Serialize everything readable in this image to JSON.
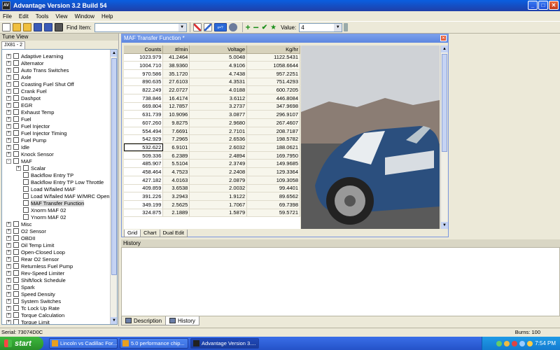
{
  "window": {
    "title": "Advantage Version 3.2 Build 54",
    "app_icon_text": "AV"
  },
  "menu": [
    "File",
    "Edit",
    "Tools",
    "View",
    "Window",
    "Help"
  ],
  "toolbar": {
    "find_label": "Find Item:",
    "find_value": "",
    "value_label": "Value:",
    "value_value": "4",
    "box_icon_text": "x=?"
  },
  "tune_view": {
    "title": "Tune View",
    "tab": "JX81 - 2",
    "items": [
      {
        "label": "Adaptive Learning",
        "level": 0,
        "expander": "+"
      },
      {
        "label": "Alternator",
        "level": 0,
        "expander": "+"
      },
      {
        "label": "Auto Trans Switches",
        "level": 0,
        "expander": "+"
      },
      {
        "label": "Axle",
        "level": 0,
        "expander": "+"
      },
      {
        "label": "Coasting Fuel Shut Off",
        "level": 0,
        "expander": "+"
      },
      {
        "label": "Crank Fuel",
        "level": 0,
        "expander": "+"
      },
      {
        "label": "Dashpot",
        "level": 0,
        "expander": "+"
      },
      {
        "label": "EGR",
        "level": 0,
        "expander": "+"
      },
      {
        "label": "Exhaust Temp",
        "level": 0,
        "expander": "+"
      },
      {
        "label": "Fuel",
        "level": 0,
        "expander": "+"
      },
      {
        "label": "Fuel Injector",
        "level": 0,
        "expander": "+"
      },
      {
        "label": "Fuel Injector Timing",
        "level": 0,
        "expander": "+"
      },
      {
        "label": "Fuel Pump",
        "level": 0,
        "expander": "+"
      },
      {
        "label": "Idle",
        "level": 0,
        "expander": "+"
      },
      {
        "label": "Knock Sensor",
        "level": 0,
        "expander": "+"
      },
      {
        "label": "MAF",
        "level": 0,
        "expander": "-"
      },
      {
        "label": "Scalar",
        "level": 1,
        "expander": "+"
      },
      {
        "label": "Backflow Entry TP",
        "level": 1,
        "expander": ""
      },
      {
        "label": "Backflow Entry TP Low Throttle",
        "level": 1,
        "expander": ""
      },
      {
        "label": "Load W/failed MAF",
        "level": 1,
        "expander": ""
      },
      {
        "label": "Load W/failed MAF W/MRC Open",
        "level": 1,
        "expander": ""
      },
      {
        "label": "MAF Transfer Function",
        "level": 1,
        "expander": "",
        "selected": true
      },
      {
        "label": "Xnorm MAF 02",
        "level": 1,
        "expander": ""
      },
      {
        "label": "Ynorm MAF 02",
        "level": 1,
        "expander": ""
      },
      {
        "label": "Misc",
        "level": 0,
        "expander": "+"
      },
      {
        "label": "O2 Sensor",
        "level": 0,
        "expander": "+"
      },
      {
        "label": "OBDII",
        "level": 0,
        "expander": "+"
      },
      {
        "label": "Oil Temp Limit",
        "level": 0,
        "expander": "+"
      },
      {
        "label": "Open-Closed Loop",
        "level": 0,
        "expander": "+"
      },
      {
        "label": "Rear O2 Sensor",
        "level": 0,
        "expander": "+"
      },
      {
        "label": "Returnless Fuel Pump",
        "level": 0,
        "expander": "+"
      },
      {
        "label": "Rev-Speed Limiter",
        "level": 0,
        "expander": "+"
      },
      {
        "label": "Shift/lock Schedule",
        "level": 0,
        "expander": "+"
      },
      {
        "label": "Spark",
        "level": 0,
        "expander": "+"
      },
      {
        "label": "Speed Density",
        "level": 0,
        "expander": "+"
      },
      {
        "label": "System Switches",
        "level": 0,
        "expander": "+"
      },
      {
        "label": "Tc Lock Up Rate",
        "level": 0,
        "expander": "+"
      },
      {
        "label": "Torque Calculation",
        "level": 0,
        "expander": "+"
      },
      {
        "label": "Torque Limit",
        "level": 0,
        "expander": "+"
      }
    ]
  },
  "maf_window": {
    "title": "MAF Transfer Function *",
    "columns": [
      "Counts",
      "#/min",
      "Voltage",
      "Kg/hr"
    ],
    "rows": [
      [
        "1023.979",
        "41.2464",
        "5.0048",
        "1122.5431"
      ],
      [
        "1004.710",
        "38.9360",
        "4.9106",
        "1058.6644"
      ],
      [
        "970.586",
        "35.1720",
        "4.7438",
        "957.2251"
      ],
      [
        "890.635",
        "27.6103",
        "4.3531",
        "751.4293"
      ],
      [
        "822.249",
        "22.0727",
        "4.0188",
        "600.7205"
      ],
      [
        "738.846",
        "16.4174",
        "3.6112",
        "446.8084"
      ],
      [
        "669.804",
        "12.7857",
        "3.2737",
        "347.9698"
      ],
      [
        "631.739",
        "10.9096",
        "3.0877",
        "296.9107"
      ],
      [
        "607.260",
        "9.8275",
        "2.9680",
        "267.4607"
      ],
      [
        "554.494",
        "7.6691",
        "2.7101",
        "208.7187"
      ],
      [
        "542.929",
        "7.2965",
        "2.6536",
        "198.5782"
      ],
      [
        "532.622",
        "6.9101",
        "2.6032",
        "188.0621"
      ],
      [
        "509.336",
        "6.2389",
        "2.4894",
        "169.7950"
      ],
      [
        "485.907",
        "5.5104",
        "2.3749",
        "149.9685"
      ],
      [
        "458.464",
        "4.7523",
        "2.2408",
        "129.3364"
      ],
      [
        "427.182",
        "4.0163",
        "2.0879",
        "109.3058"
      ],
      [
        "409.859",
        "3.6538",
        "2.0032",
        "99.4401"
      ],
      [
        "391.226",
        "3.2943",
        "1.9122",
        "89.6562"
      ],
      [
        "349.199",
        "2.5625",
        "1.7067",
        "69.7398"
      ],
      [
        "324.875",
        "2.1889",
        "1.5879",
        "59.5721"
      ]
    ],
    "selected_row": 11,
    "tabs": [
      "Grid",
      "Chart",
      "Dual Edit"
    ]
  },
  "history": {
    "title": "History",
    "tabs": [
      "Description",
      "History"
    ]
  },
  "status": {
    "serial": "Serial: 73074D0C",
    "burns": "Burns: 100"
  },
  "taskbar": {
    "start": "start",
    "tasks": [
      {
        "label": "Lincoln vs Cadillac For...",
        "icon_color": "#e8a020"
      },
      {
        "label": "5.0 performance chip...",
        "icon_color": "#e8a020"
      },
      {
        "label": "Advantage Version 3....",
        "icon_color": "#222222",
        "active": true
      }
    ],
    "clock": "7:54 PM"
  },
  "colors": {
    "accent": "#0a5fe0",
    "tree_select": "#d9d9d9",
    "grid_header": "#d7d2bc"
  }
}
